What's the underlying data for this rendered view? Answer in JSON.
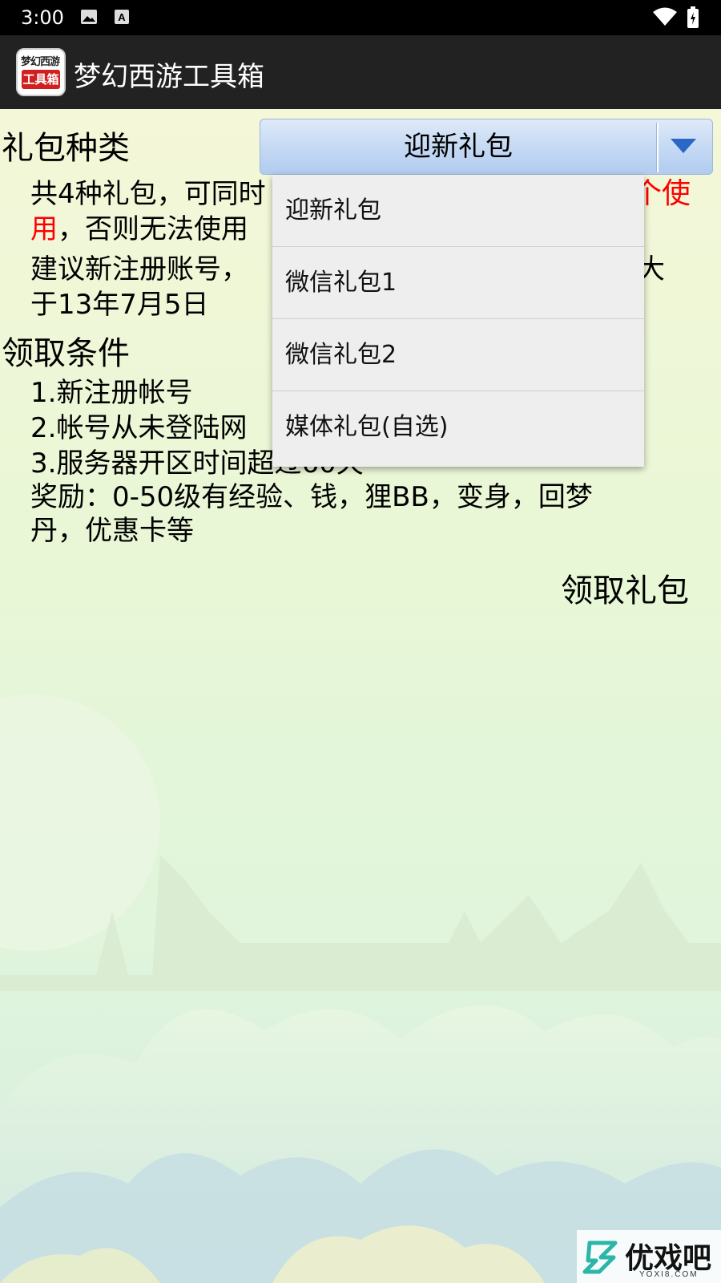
{
  "status_bar": {
    "time": "3:00"
  },
  "app_bar": {
    "logo_top": "梦幻西游",
    "logo_bottom": "工具箱",
    "title": "梦幻西游工具箱"
  },
  "gift_type": {
    "label": "礼包种类",
    "selected": "迎新礼包",
    "options": [
      "迎新礼包",
      "微信礼包1",
      "微信礼包2",
      "媒体礼包(自选)"
    ]
  },
  "description": {
    "line1_start": "共4种礼包，可同时",
    "line1_red_end": "个使",
    "line2_red": "用",
    "line2_rest": "，否则无法使用",
    "line3_start": "建议新注册账号，",
    "line3_end": "大",
    "line4": "于13年7月5日"
  },
  "conditions": {
    "label": "领取条件",
    "item1": "1.新注册帐号",
    "item2": "2.帐号从未登陆网",
    "item3": "3.服务器开区时间超过60天",
    "reward_line1": "奖励：0-50级有经验、钱，狸BB，变身，回梦",
    "reward_line2": "丹，优惠卡等"
  },
  "claim_button": "领取礼包",
  "watermark": {
    "brand": "优戏吧",
    "domain": "YOXI8.COM"
  },
  "colors": {
    "highlight": "#ff0000",
    "app_bar": "#222222",
    "spinner": "#c3d8f3"
  }
}
